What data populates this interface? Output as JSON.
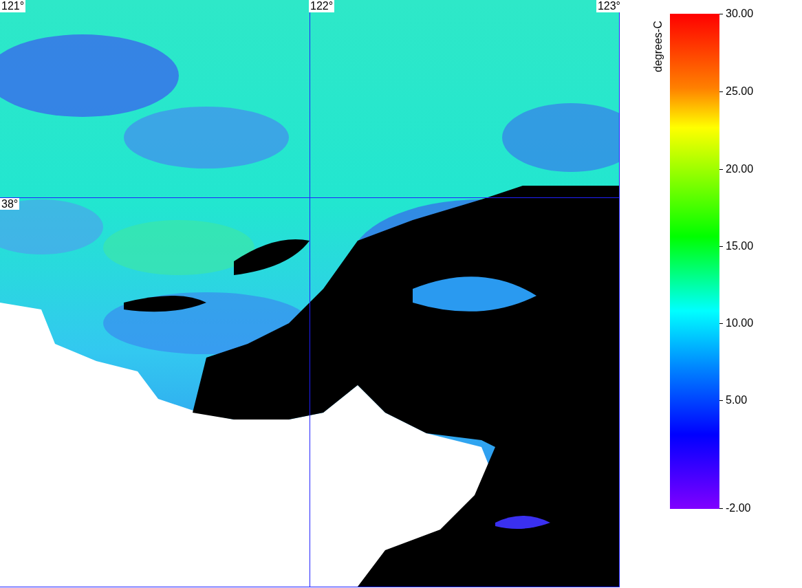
{
  "map": {
    "lon_labels": [
      "121°",
      "122°",
      "123°"
    ],
    "lat_labels": [
      "38°"
    ]
  },
  "colorbar": {
    "unit": "degrees-C",
    "ticks": [
      "30.00",
      "25.00",
      "20.00",
      "15.00",
      "10.00",
      "5.00",
      "-2.00"
    ]
  }
}
